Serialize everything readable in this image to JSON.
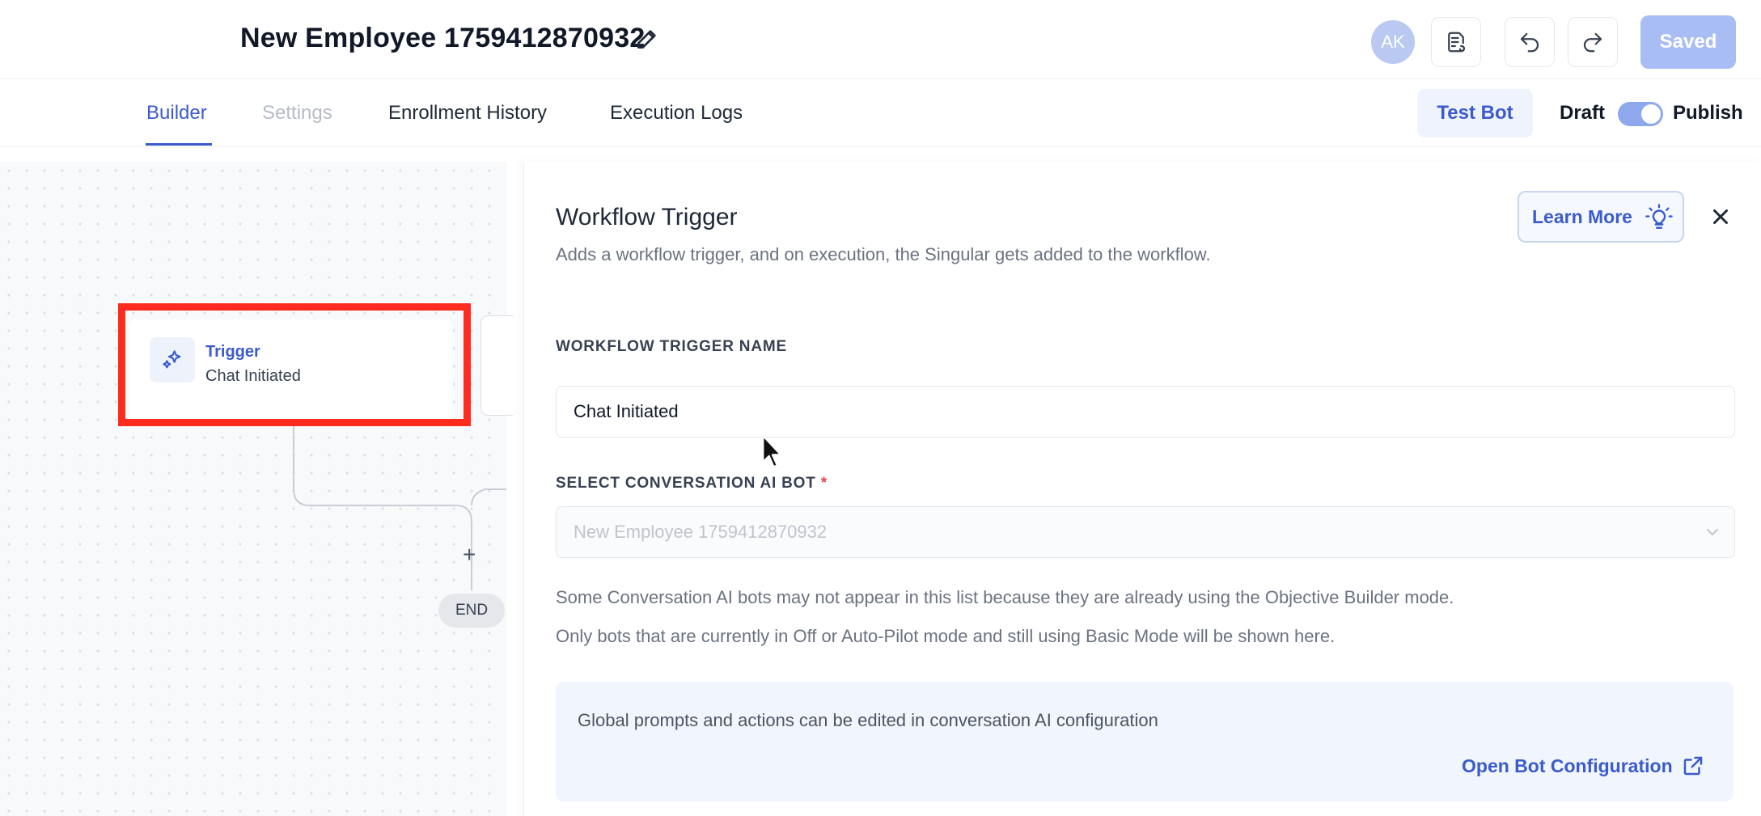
{
  "header": {
    "title": "New Employee 1759412870932",
    "avatar_initials": "AK",
    "saved_label": "Saved"
  },
  "tabs": [
    {
      "label": "Builder",
      "state": "active"
    },
    {
      "label": "Settings",
      "state": "disabled"
    },
    {
      "label": "Enrollment History",
      "state": "normal"
    },
    {
      "label": "Execution Logs",
      "state": "normal"
    }
  ],
  "toolbar": {
    "test_bot_label": "Test Bot",
    "draft_label": "Draft",
    "publish_label": "Publish",
    "publish_toggle_on": true
  },
  "canvas": {
    "trigger_node": {
      "title": "Trigger",
      "subtitle": "Chat Initiated"
    },
    "add_symbol": "+",
    "end_label": "END"
  },
  "panel": {
    "title": "Workflow Trigger",
    "description": "Adds a workflow trigger, and on execution, the Singular gets added to the workflow.",
    "learn_more_label": "Learn More",
    "trigger_name_label": "WORKFLOW TRIGGER NAME",
    "trigger_name_value": "Chat Initiated",
    "bot_label": "SELECT CONVERSATION AI BOT",
    "bot_required_mark": "*",
    "bot_selected_value": "New Employee 1759412870932",
    "help_line_1": "Some Conversation AI bots may not appear in this list because they are already using the Objective Builder mode.",
    "help_line_2": "Only bots that are currently in Off or Auto-Pilot mode and still using Basic Mode will be shown here.",
    "info_text": "Global prompts and actions can be edited in conversation AI configuration",
    "open_bot_label": "Open Bot Configuration"
  },
  "colors": {
    "accent": "#3b5bcc",
    "highlight_box": "#ff2b1e",
    "saved_button": "#a8bdf4"
  }
}
